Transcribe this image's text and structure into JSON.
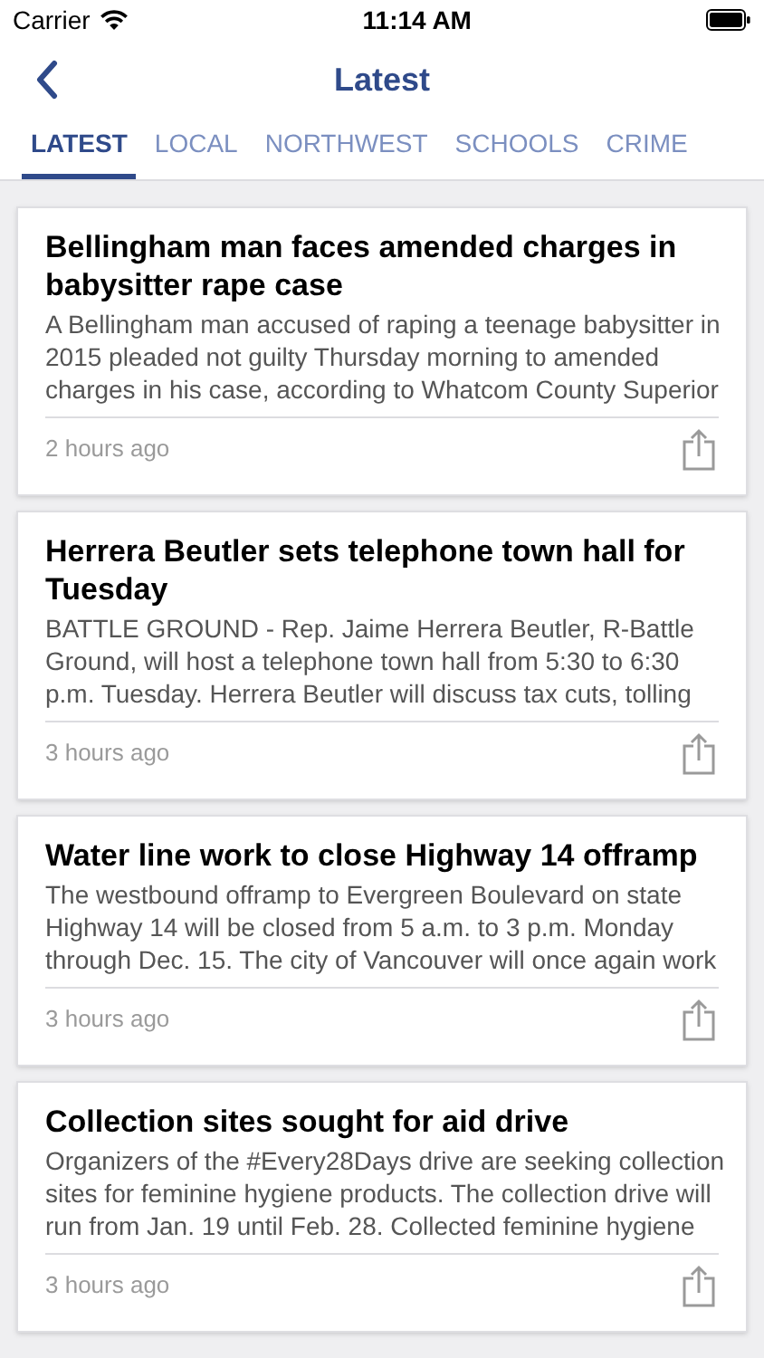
{
  "status_bar": {
    "carrier": "Carrier",
    "time": "11:14 AM"
  },
  "nav": {
    "title": "Latest"
  },
  "tabs": [
    {
      "label": "LATEST",
      "selected": true
    },
    {
      "label": "LOCAL",
      "selected": false
    },
    {
      "label": "NORTHWEST",
      "selected": false
    },
    {
      "label": "SCHOOLS",
      "selected": false
    },
    {
      "label": "CRIME",
      "selected": false
    }
  ],
  "articles": [
    {
      "title": "Bellingham man faces amended charges in babysitter rape case",
      "excerpt_lines": [
        "A Bellingham man accused of raping a teenage babysitter in",
        "2015 pleaded not guilty Thursday morning to amended",
        "charges in his case, according to Whatcom County Superior"
      ],
      "time": "2 hours ago"
    },
    {
      "title": "Herrera Beutler sets telephone town hall for Tuesday",
      "excerpt_lines": [
        "BATTLE GROUND - Rep. Jaime Herrera Beutler, R-Battle",
        "Ground, will host a telephone town hall from 5:30 to 6:30",
        "p.m. Tuesday. Herrera Beutler will discuss tax cuts, tolling"
      ],
      "time": "3 hours ago"
    },
    {
      "title": "Water line work to close Highway 14 offramp",
      "excerpt_lines": [
        "The westbound offramp to Evergreen Boulevard on state",
        "Highway 14 will be closed from 5 a.m. to 3 p.m. Monday",
        "through Dec. 15. The city of Vancouver will once again work"
      ],
      "time": "3 hours ago"
    },
    {
      "title": "Collection sites sought for aid drive",
      "excerpt_lines": [
        "Organizers of the #Every28Days drive are seeking collection",
        "sites for feminine hygiene products. The collection drive will",
        "run from Jan. 19 until Feb. 28. Collected feminine hygiene"
      ],
      "time": "3 hours ago"
    }
  ]
}
